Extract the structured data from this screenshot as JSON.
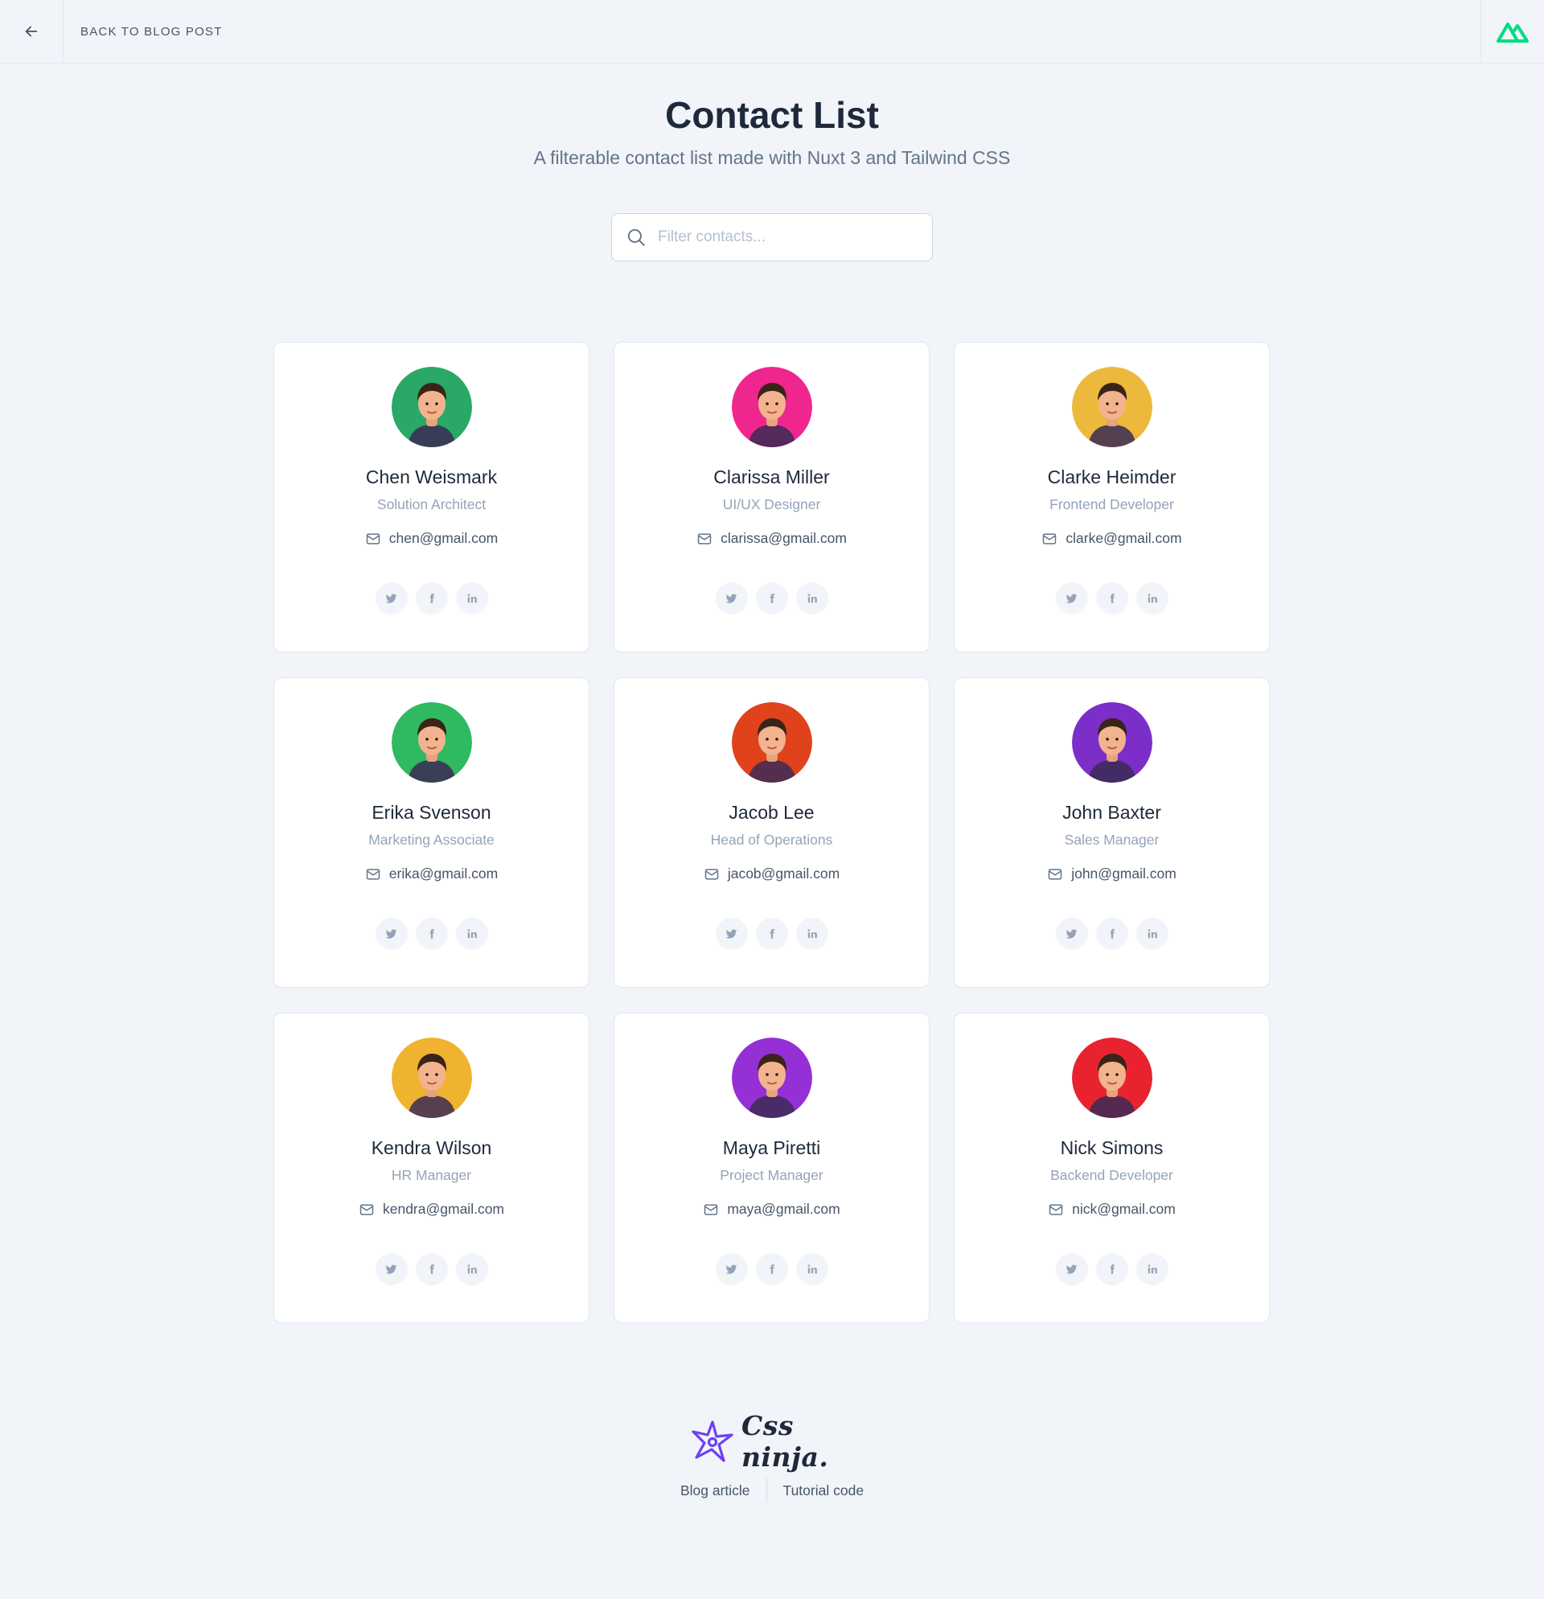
{
  "topbar": {
    "back_label": "BACK TO BLOG POST",
    "back_icon": "arrow-left-icon",
    "logo_icon": "nuxt-logo-icon",
    "logo_color": "#00dc82"
  },
  "header": {
    "title": "Contact List",
    "subtitle": "A filterable contact list made with Nuxt 3 and Tailwind CSS"
  },
  "search": {
    "placeholder": "Filter contacts...",
    "value": "",
    "icon": "search-icon"
  },
  "contacts": [
    {
      "name": "Chen Weismark",
      "role": "Solution Architect",
      "email": "chen@gmail.com",
      "avatar_color": "#2aa868"
    },
    {
      "name": "Clarissa Miller",
      "role": "UI/UX Designer",
      "email": "clarissa@gmail.com",
      "avatar_color": "#f0268f"
    },
    {
      "name": "Clarke Heimder",
      "role": "Frontend Developer",
      "email": "clarke@gmail.com",
      "avatar_color": "#ecb93c"
    },
    {
      "name": "Erika Svenson",
      "role": "Marketing Associate",
      "email": "erika@gmail.com",
      "avatar_color": "#2fba62"
    },
    {
      "name": "Jacob Lee",
      "role": "Head of Operations",
      "email": "jacob@gmail.com",
      "avatar_color": "#e0421c"
    },
    {
      "name": "John Baxter",
      "role": "Sales Manager",
      "email": "john@gmail.com",
      "avatar_color": "#7b2fc8"
    },
    {
      "name": "Kendra Wilson",
      "role": "HR Manager",
      "email": "kendra@gmail.com",
      "avatar_color": "#f0b32f"
    },
    {
      "name": "Maya Piretti",
      "role": "Project Manager",
      "email": "maya@gmail.com",
      "avatar_color": "#9430d6"
    },
    {
      "name": "Nick Simons",
      "role": "Backend Developer",
      "email": "nick@gmail.com",
      "avatar_color": "#e8232f"
    }
  ],
  "social_icons": [
    "twitter-icon",
    "facebook-icon",
    "linkedin-icon"
  ],
  "footer": {
    "brand": "Css ninja.",
    "brand_color": "#6f3ff5",
    "links": [
      "Blog article",
      "Tutorial code"
    ]
  },
  "colors": {
    "background": "#f1f4f8",
    "card": "#ffffff",
    "border": "#e2e8f0",
    "text": "#1e293b",
    "muted": "#94a3b8"
  }
}
